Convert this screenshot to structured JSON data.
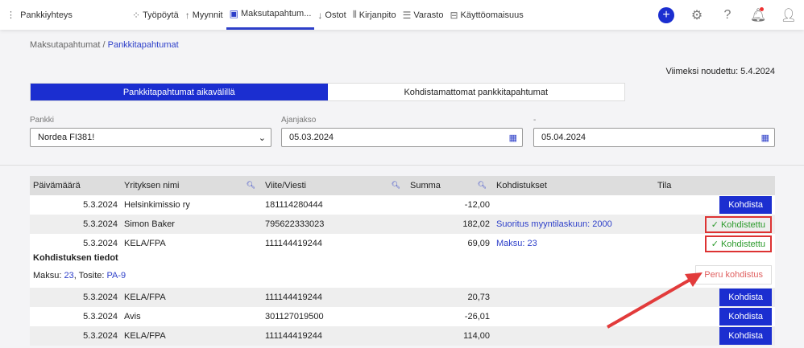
{
  "brand": "Pankkiyhteys",
  "nav": [
    {
      "icon": "dashboard-icon",
      "glyph": "⁘",
      "label": "Työpöytä"
    },
    {
      "icon": "arrow-up-icon",
      "glyph": "↑",
      "label": "Myynnit"
    },
    {
      "icon": "payment-icon",
      "glyph": "▣",
      "label": "Maksutapahtum..."
    },
    {
      "icon": "arrow-down-icon",
      "glyph": "↓",
      "label": "Ostot"
    },
    {
      "icon": "bar-chart-icon",
      "glyph": "⫴",
      "label": "Kirjanpito"
    },
    {
      "icon": "inventory-icon",
      "glyph": "☰",
      "label": "Varasto"
    },
    {
      "icon": "briefcase-icon",
      "glyph": "⊟",
      "label": "Käyttöomaisuus"
    }
  ],
  "breadcrumb": {
    "parent": "Maksutapahtumat",
    "sep": " / ",
    "current": "Pankkitapahtumat"
  },
  "last_fetched": "Viimeksi noudettu: 5.4.2024",
  "tabs": [
    "Pankkitapahtumat aikavälillä",
    "Kohdistamattomat pankkitapahtumat"
  ],
  "filters": {
    "bank_label": "Pankki",
    "bank_value": "Nordea FI381!",
    "period_label": "Ajanjakso",
    "start": "05.03.2024",
    "end_label": "-",
    "end": "05.04.2024"
  },
  "columns": [
    "Päivämäärä",
    "Yrityksen nimi",
    "Viite/Viesti",
    "Summa",
    "Kohdistukset",
    "Tila"
  ],
  "rows": [
    {
      "date": "5.3.2024",
      "name": "Helsinkimissio ry",
      "ref": "181114280444",
      "sum": "-12,00",
      "alloc": "",
      "status": "Kohdista"
    },
    {
      "date": "5.3.2024",
      "name": "Simon Baker",
      "ref": "795622333023",
      "sum": "182,02",
      "alloc": "Suoritus myyntilaskuun: 2000",
      "status": "✓ Kohdistettu"
    },
    {
      "date": "5.3.2024",
      "name": "KELA/FPA",
      "ref": "111144419244",
      "sum": "69,09",
      "alloc": "Maksu: 23",
      "status": "✓ Kohdistettu"
    },
    {
      "date": "5.3.2024",
      "name": "KELA/FPA",
      "ref": "111144419244",
      "sum": "20,73",
      "alloc": "",
      "status": "Kohdista"
    },
    {
      "date": "5.3.2024",
      "name": "Avis",
      "ref": "301127019500",
      "sum": "-26,01",
      "alloc": "",
      "status": "Kohdista"
    },
    {
      "date": "5.3.2024",
      "name": "KELA/FPA",
      "ref": "111144419244",
      "sum": "114,00",
      "alloc": "",
      "status": "Kohdista"
    }
  ],
  "details": {
    "title": "Kohdistuksen tiedot",
    "maksu_label": "Maksu: ",
    "maksu": "23",
    "tosite_label": ", Tosite: ",
    "tosite": "PA-9",
    "undo": "Peru kohdistus"
  }
}
